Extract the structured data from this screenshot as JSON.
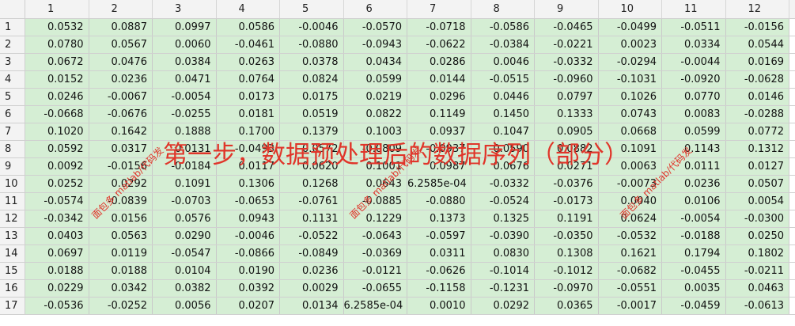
{
  "columns": [
    "1",
    "2",
    "3",
    "4",
    "5",
    "6",
    "7",
    "8",
    "9",
    "10",
    "11",
    "12"
  ],
  "rows": [
    {
      "label": "1",
      "cells": [
        "0.0532",
        "0.0887",
        "0.0997",
        "0.0586",
        "-0.0046",
        "-0.0570",
        "-0.0718",
        "-0.0586",
        "-0.0465",
        "-0.0499",
        "-0.0511",
        "-0.0156"
      ]
    },
    {
      "label": "2",
      "cells": [
        "0.0780",
        "0.0567",
        "0.0060",
        "-0.0461",
        "-0.0880",
        "-0.0943",
        "-0.0622",
        "-0.0384",
        "-0.0221",
        "0.0023",
        "0.0334",
        "0.0544"
      ]
    },
    {
      "label": "3",
      "cells": [
        "0.0672",
        "0.0476",
        "0.0384",
        "0.0263",
        "0.0378",
        "0.0434",
        "0.0286",
        "0.0046",
        "-0.0332",
        "-0.0294",
        "-0.0044",
        "0.0169"
      ]
    },
    {
      "label": "4",
      "cells": [
        "0.0152",
        "0.0236",
        "0.0471",
        "0.0764",
        "0.0824",
        "0.0599",
        "0.0144",
        "-0.0515",
        "-0.0960",
        "-0.1031",
        "-0.0920",
        "-0.0628"
      ]
    },
    {
      "label": "5",
      "cells": [
        "0.0246",
        "-0.0067",
        "-0.0054",
        "0.0173",
        "0.0175",
        "0.0219",
        "0.0296",
        "0.0446",
        "0.0797",
        "0.1026",
        "0.0770",
        "0.0146"
      ]
    },
    {
      "label": "6",
      "cells": [
        "-0.0668",
        "-0.0676",
        "-0.0255",
        "0.0181",
        "0.0519",
        "0.0822",
        "0.1149",
        "0.1450",
        "0.1333",
        "0.0743",
        "0.0083",
        "-0.0288"
      ]
    },
    {
      "label": "7",
      "cells": [
        "0.1020",
        "0.1642",
        "0.1888",
        "0.1700",
        "0.1379",
        "0.1003",
        "0.0937",
        "0.1047",
        "0.0905",
        "0.0668",
        "0.0599",
        "0.0772"
      ]
    },
    {
      "label": "8",
      "cells": [
        "0.0592",
        "0.0317",
        "0.0131",
        "-0.0493",
        "-0.0572",
        "-0.0809",
        "-0.0937",
        "-0.0590",
        "0.0882",
        "0.1091",
        "0.1143",
        "0.1312"
      ]
    },
    {
      "label": "9",
      "cells": [
        "0.0092",
        "-0.0156",
        "-0.0184",
        "0.0117",
        "0.0620",
        "0.1001",
        "0.0987",
        "0.0676",
        "0.0271",
        "0.0063",
        "0.0111",
        "0.0127"
      ]
    },
    {
      "label": "10",
      "cells": [
        "0.0252",
        "0.0292",
        "0.1091",
        "0.1306",
        "0.1268",
        "0.0643",
        "6.2585e-04",
        "-0.0332",
        "-0.0376",
        "-0.0073",
        "0.0236",
        "0.0507"
      ]
    },
    {
      "label": "11",
      "cells": [
        "-0.0574",
        "-0.0839",
        "-0.0703",
        "-0.0653",
        "-0.0761",
        "-0.0885",
        "-0.0880",
        "-0.0524",
        "-0.0173",
        "0.0040",
        "0.0106",
        "0.0054"
      ]
    },
    {
      "label": "12",
      "cells": [
        "-0.0342",
        "0.0156",
        "0.0576",
        "0.0943",
        "0.1131",
        "0.1229",
        "0.1373",
        "0.1325",
        "0.1191",
        "0.0624",
        "-0.0054",
        "-0.0300"
      ]
    },
    {
      "label": "13",
      "cells": [
        "0.0403",
        "0.0563",
        "0.0290",
        "-0.0046",
        "-0.0522",
        "-0.0643",
        "-0.0597",
        "-0.0390",
        "-0.0350",
        "-0.0532",
        "-0.0188",
        "0.0250"
      ]
    },
    {
      "label": "14",
      "cells": [
        "0.0697",
        "0.0119",
        "-0.0547",
        "-0.0866",
        "-0.0849",
        "-0.0369",
        "0.0311",
        "0.0830",
        "0.1308",
        "0.1621",
        "0.1794",
        "0.1802"
      ]
    },
    {
      "label": "15",
      "cells": [
        "0.0188",
        "0.0188",
        "0.0104",
        "0.0190",
        "0.0236",
        "-0.0121",
        "-0.0626",
        "-0.1014",
        "-0.1012",
        "-0.0682",
        "-0.0455",
        "-0.0211"
      ]
    },
    {
      "label": "16",
      "cells": [
        "0.0229",
        "0.0342",
        "0.0382",
        "0.0392",
        "0.0029",
        "-0.0655",
        "-0.1158",
        "-0.1231",
        "-0.0970",
        "-0.0551",
        "0.0035",
        "0.0463"
      ]
    },
    {
      "label": "17",
      "cells": [
        "-0.0536",
        "-0.0252",
        "0.0056",
        "0.0207",
        "0.0134",
        "6.2585e-04",
        "0.0010",
        "0.0292",
        "0.0365",
        "-0.0017",
        "-0.0459",
        "-0.0613"
      ]
    }
  ],
  "overlay": {
    "caption": "第一步，数据预处理后的数据序列（部分）",
    "watermark": "面包多 matlab/代码发"
  }
}
